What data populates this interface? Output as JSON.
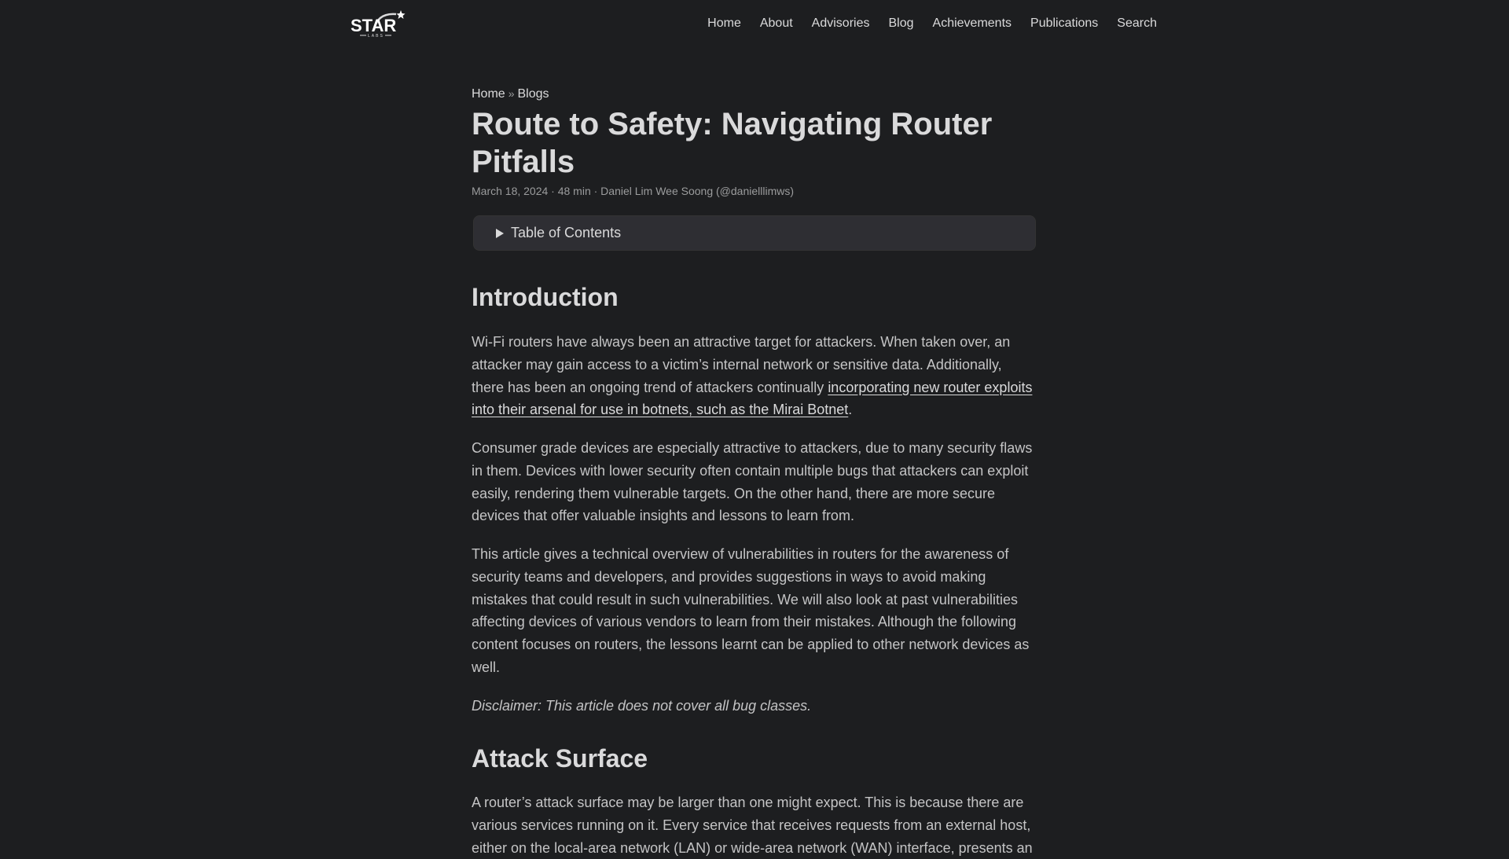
{
  "header": {
    "logo_text": "STAR",
    "logo_subtext": "LABS",
    "nav": [
      {
        "label": "Home"
      },
      {
        "label": "About"
      },
      {
        "label": "Advisories"
      },
      {
        "label": "Blog"
      },
      {
        "label": "Achievements"
      },
      {
        "label": "Publications"
      },
      {
        "label": "Search"
      }
    ]
  },
  "breadcrumb": {
    "items": [
      "Home",
      "Blogs"
    ],
    "separator": "»"
  },
  "post": {
    "title": "Route to Safety: Navigating Router Pitfalls",
    "meta": "March 18, 2024 · 48 min · Daniel Lim Wee Soong (@danielllimws)",
    "toc_label": "Table of Contents"
  },
  "content": {
    "intro_heading": "Introduction",
    "p1_before": "Wi-Fi routers have always been an attractive target for attackers. When taken over, an attacker may gain access to a victim’s internal network or sensitive data. Additionally, there has been an ongoing trend of attackers continually ",
    "p1_link": "incorporating new router exploits into their arsenal for use in botnets, such as the Mirai Botnet",
    "p1_after": ".",
    "p2": "Consumer grade devices are especially attractive to attackers, due to many security flaws in them. Devices with lower security often contain multiple bugs that attackers can exploit easily, rendering them vulnerable targets. On the other hand, there are more secure devices that offer valuable insights and lessons to learn from.",
    "p3": "This article gives a technical overview of vulnerabilities in routers for the awareness of security teams and developers, and provides suggestions in ways to avoid making mistakes that could result in such vulnerabilities. We will also look at past vulnerabilities affecting devices of various vendors to learn from their mistakes. Although the following content focuses on routers, the lessons learnt can be applied to other network devices as well.",
    "disclaimer": "Disclaimer: This article does not cover all bug classes.",
    "attack_heading": "Attack Surface",
    "p4": "A router’s attack surface may be larger than one might expect. This is because there are various services running on it. Every service that receives requests from an external host, either on the local-area network (LAN) or wide-area network (WAN) interface, presents an"
  }
}
